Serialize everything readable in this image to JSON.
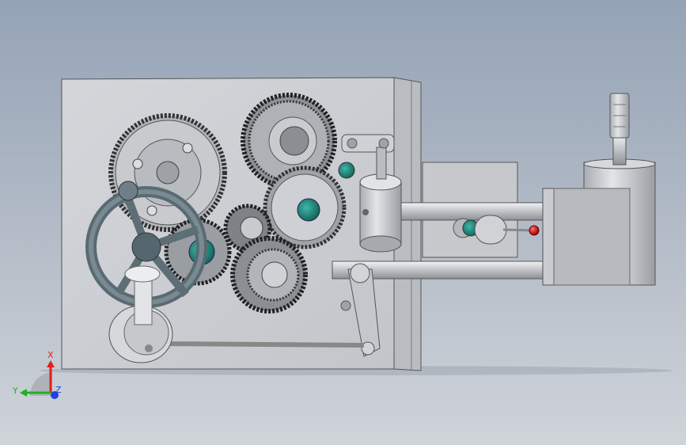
{
  "viewport": {
    "background_top": "#94a3b6",
    "background_bottom": "#cfd4da"
  },
  "model": {
    "parts": {
      "plate": "base-plate",
      "gears": "gear-train",
      "handwheel": "handwheel",
      "shafts": "guide-rods",
      "housing": "cylinder-housing",
      "lever": "linkage-lever",
      "knob": "red-ball-knob"
    }
  },
  "triad": {
    "x_label": "X",
    "y_label": "Y",
    "z_label": "Z",
    "x_color": "#e02020",
    "y_color": "#20b020",
    "z_color": "#2040e0"
  }
}
